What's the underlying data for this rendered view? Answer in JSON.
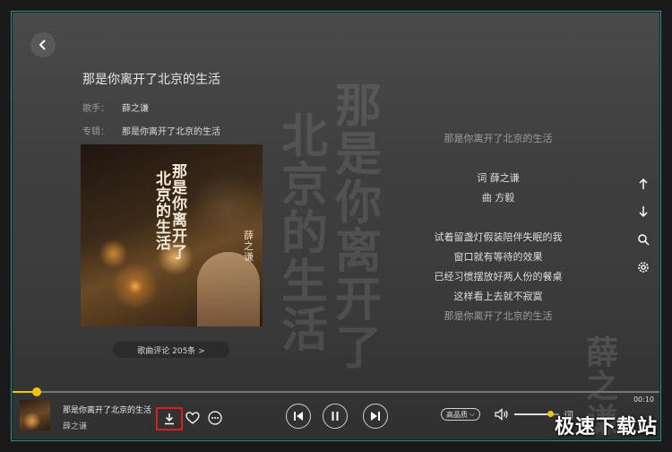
{
  "song": {
    "title": "那是你离开了北京的生活",
    "singer_label": "歌手：",
    "singer": "薛之谦",
    "album_label": "专辑：",
    "album": "那是你离开了北京的生活"
  },
  "cover": {
    "title_col1": "那是你离开了",
    "title_col2": "北京的生活",
    "artist_sig": "薛之谦"
  },
  "background_text": {
    "col1": "那是你离开了",
    "col2": "北京的生活",
    "col3": "薛之谦"
  },
  "comments": {
    "label": "歌曲评论 205条 >"
  },
  "lyrics": [
    {
      "text": "那是你离开了北京的生活",
      "dim": true
    },
    {
      "text": "词 薛之谦",
      "dim": false
    },
    {
      "text": "曲 方毅",
      "dim": false
    },
    {
      "text": "试着留盏灯假装陪伴失眠的我",
      "dim": false
    },
    {
      "text": "窗口就有等待的效果",
      "dim": false
    },
    {
      "text": "已经习惯摆放好两人份的餐桌",
      "dim": false
    },
    {
      "text": "这样看上去就不寂寞",
      "dim": false
    },
    {
      "text": "那是你离开了北京的生活",
      "dim": true
    }
  ],
  "player": {
    "now_playing_title": "那是你离开了北京的生活",
    "now_playing_artist": "薛之谦",
    "time": "00:10",
    "progress": 0.038,
    "volume": 0.8,
    "quality_label": "高品质",
    "lyric_toggle": "词"
  },
  "watermark": "极速下载站",
  "colors": {
    "accent": "#f5c400",
    "highlight_border": "#d61f1f"
  },
  "icons": [
    "back-arrow-icon",
    "arrow-up-icon",
    "arrow-down-icon",
    "search-icon",
    "gear-icon",
    "download-icon",
    "heart-icon",
    "more-icon",
    "prev-icon",
    "pause-icon",
    "next-icon",
    "volume-icon"
  ]
}
